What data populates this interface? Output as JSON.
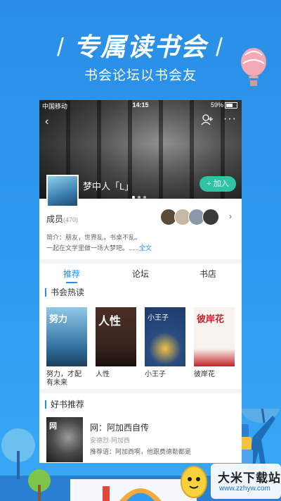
{
  "promo": {
    "headline": "专属读书会",
    "slash_left": "/",
    "slash_right": "/",
    "subline": "书会论坛以书会友"
  },
  "status_bar": {
    "carrier": "中国移动",
    "time": "14:15",
    "battery": "59%"
  },
  "group": {
    "name": "梦中人「L」",
    "join_label": "+ 加入",
    "members_label": "成员",
    "members_count": "(470)",
    "intro_line1": "简介：朋友，世界乱，书桌不乱。",
    "intro_line2": "一起在文学里做一场大梦吧。......",
    "intro_more": "全文"
  },
  "tabs": [
    {
      "label": "推荐"
    },
    {
      "label": "论坛"
    },
    {
      "label": "书店"
    }
  ],
  "hot_section": {
    "title": "书会热读",
    "books": [
      {
        "title": "努力，才配有未来",
        "cover_text": "努力",
        "cover_color": "#2f6e9e"
      },
      {
        "title": "人性",
        "cover_text": "人性",
        "cover_color": "#3b2620"
      },
      {
        "title": "小王子",
        "cover_text": "小王子",
        "cover_color": "#1d3a6b"
      },
      {
        "title": "彼岸花",
        "cover_text": "彼岸花",
        "cover_color": "#c2242a"
      }
    ]
  },
  "rec_section": {
    "title": "好书推荐",
    "book_title": "网：阿加西自传",
    "book_author": "安德烈·阿加西",
    "book_desc": "推荐语：阿加西啊，他跟费德勒都是",
    "cover_letter": "网"
  },
  "watermark": {
    "name": "大米下载站",
    "url": "www.zzhyw.com"
  },
  "colors": {
    "background": "#2f9bf0",
    "accent": "#2a8ee6",
    "join_button": "#2ec4a4"
  }
}
